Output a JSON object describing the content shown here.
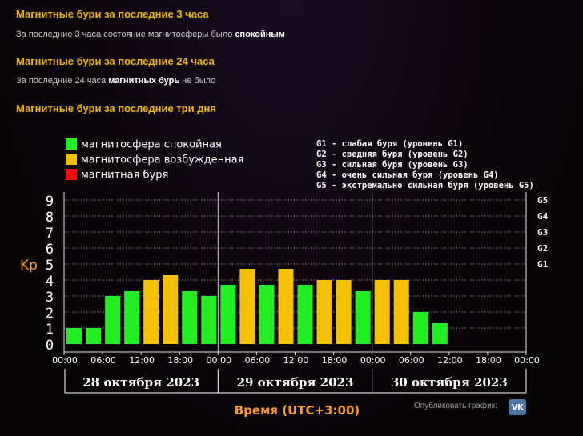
{
  "sections": {
    "s3h_title": "Магнитные бури за последние 3 часа",
    "s3h_text_pre": "За последние 3 часа состояние магнитосферы было ",
    "s3h_text_bold": "спокойным",
    "s24h_title": "Магнитные бури за последние 24 часа",
    "s24h_text_pre": "За последние 24 часа ",
    "s24h_text_bold": "магнитных бурь",
    "s24h_text_post": " не было",
    "s3d_title": "Магнитные бури за последние три дня"
  },
  "share": {
    "label": "Опубликовать график:",
    "icon": "vk-icon",
    "icon_text": "VK"
  },
  "colors": {
    "calm": "#22ee22",
    "excited": "#f5c000",
    "storm": "#ee1111",
    "accent": "#f5b800",
    "xaxis_title": "#ff9a2a"
  },
  "chart_data": {
    "type": "bar",
    "ylabel": "Kp",
    "xlabel": "Время (UTC+3:00)",
    "ylim": [
      0,
      9
    ],
    "yticks": [
      "0",
      "1",
      "2",
      "3",
      "4",
      "5",
      "6",
      "7",
      "8",
      "9"
    ],
    "g_levels": [
      {
        "label": "G1",
        "kp": 5
      },
      {
        "label": "G2",
        "kp": 6
      },
      {
        "label": "G3",
        "kp": 7
      },
      {
        "label": "G4",
        "kp": 8
      },
      {
        "label": "G5",
        "kp": 9
      }
    ],
    "g_legend": [
      "G1 - слабая буря (уровень G1)",
      "G2 - средняя буря (уровень G2)",
      "G3 - сильная буря (уровень G3)",
      "G4 - очень сильная буря (уровень G4)",
      "G5 - экстремально сильная буря (уровень G5)"
    ],
    "legend": [
      {
        "label": "магнитосфера спокойная",
        "color": "#22ee22"
      },
      {
        "label": "магнитосфера возбужденная",
        "color": "#f5c000"
      },
      {
        "label": "магнитная буря",
        "color": "#ee1111"
      }
    ],
    "time_ticks": [
      "00:00",
      "06:00",
      "12:00",
      "18:00"
    ],
    "days": [
      "28 октября 2023",
      "29 октября 2023",
      "30 октября 2023"
    ],
    "bars_per_day": 8,
    "values": [
      1,
      1,
      3,
      3.3,
      4,
      4.3,
      3.3,
      3,
      3.7,
      4.7,
      3.7,
      4.7,
      3.7,
      4,
      4,
      3.3,
      4,
      4,
      2,
      1.3
    ],
    "states": [
      "calm",
      "calm",
      "calm",
      "calm",
      "excited",
      "excited",
      "calm",
      "calm",
      "calm",
      "excited",
      "calm",
      "excited",
      "calm",
      "excited",
      "excited",
      "calm",
      "excited",
      "excited",
      "calm",
      "calm"
    ]
  }
}
